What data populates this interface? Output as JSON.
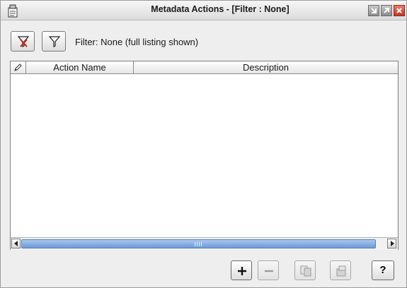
{
  "window": {
    "title": "Metadata Actions - [Filter : None]",
    "icons": {
      "app": "clipboard-app-icon",
      "minimize": "minimize-icon",
      "maximize": "maximize-icon",
      "close": "close-icon"
    }
  },
  "toolbar": {
    "clear_filter_icon": "funnel-clear-icon",
    "filter_icon": "funnel-icon",
    "filter_status": "Filter: None (full listing shown)"
  },
  "table": {
    "columns": [
      {
        "label": "",
        "icon": "pencil-icon"
      },
      {
        "label": "Action Name"
      },
      {
        "label": "Description"
      }
    ],
    "rows": []
  },
  "actions": {
    "add": {
      "icon": "plus-icon"
    },
    "remove": {
      "icon": "minus-icon",
      "enabled": false
    },
    "copy": {
      "icon": "copy-icon",
      "enabled": false
    },
    "properties": {
      "icon": "properties-icon",
      "enabled": false
    },
    "help": {
      "label": "?"
    }
  },
  "colors": {
    "scroll_thumb": "#7fa6dc",
    "close_button": "#d9432f",
    "window_bg": "#eeeeee"
  }
}
